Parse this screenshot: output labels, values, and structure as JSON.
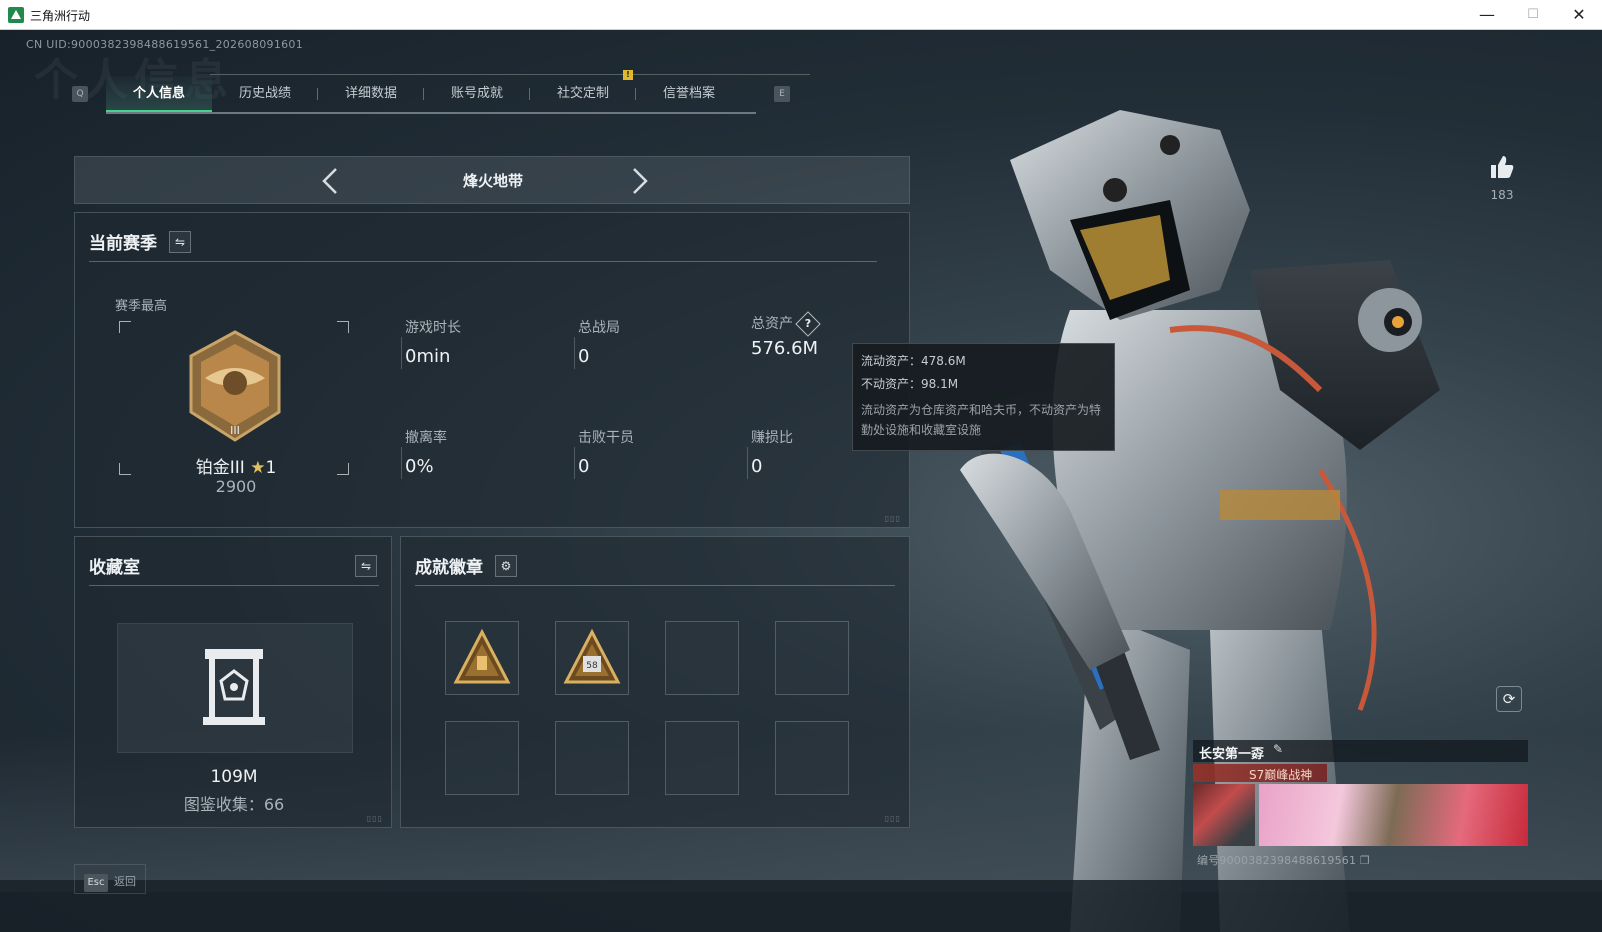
{
  "window": {
    "title": "三角洲行动",
    "min": "—",
    "max": "☐",
    "close": "✕"
  },
  "uid": "CN UID:9000382398488619561_202608091601",
  "bg_word": "个人信息",
  "tabs": {
    "left_key": "Q",
    "right_key": "E",
    "notification": "!",
    "items": [
      "个人信息",
      "历史战绩",
      "详细数据",
      "账号成就",
      "社交定制",
      "信誉档案"
    ]
  },
  "mode": {
    "label": "烽火地带"
  },
  "season": {
    "title": "当前赛季",
    "best_label": "赛季最高",
    "rank_name": "铂金III",
    "rank_star": "★",
    "rank_stars": "1",
    "rank_score": "2900",
    "medal_numeral": "III",
    "stats": {
      "playtime": {
        "label": "游戏时长",
        "value": "0min"
      },
      "matches": {
        "label": "总战局",
        "value": "0"
      },
      "assets": {
        "label": "总资产",
        "value": "576.6M",
        "help": "?"
      },
      "extract": {
        "label": "撤离率",
        "value": "0%"
      },
      "kills": {
        "label": "击败干员",
        "value": "0"
      },
      "ratio": {
        "label": "赚损比",
        "value": "0"
      }
    }
  },
  "tooltip": {
    "liquid": "流动资产：478.6M",
    "fixed": "不动资产：98.1M",
    "desc": "流动资产为仓库资产和哈夫币，不动资产为特勤处设施和收藏室设施"
  },
  "collection": {
    "title": "收藏室",
    "value": "109M",
    "sub": "图鉴收集：66"
  },
  "achievements": {
    "title": "成就徽章",
    "badge_b_text": "58"
  },
  "likes": {
    "count": "183"
  },
  "card": {
    "name": "长安第一孬",
    "title": "S7巅峰战神",
    "id": "编号9000382398488619561"
  },
  "esc": {
    "key": "Esc",
    "label": "返回"
  },
  "colors": {
    "accent": "#44d28c",
    "panel_border": "#78848c"
  }
}
